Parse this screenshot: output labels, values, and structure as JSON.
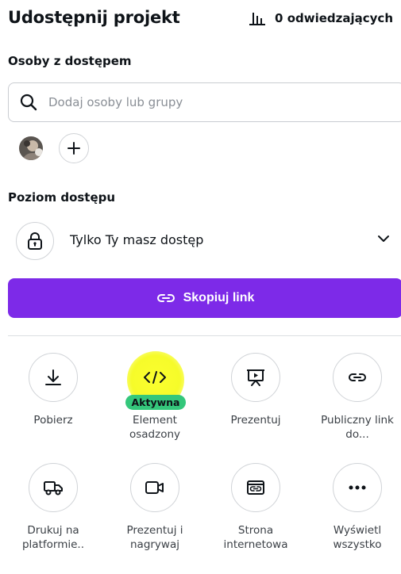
{
  "header": {
    "title": "Udostępnij projekt",
    "visitors": "0 odwiedzających"
  },
  "people": {
    "label": "Osoby z dostępem",
    "search_placeholder": "Dodaj osoby lub grupy"
  },
  "access": {
    "label": "Poziom dostępu",
    "value": "Tylko Ty masz dostęp"
  },
  "copy_link": {
    "label": "Skopiuj link"
  },
  "actions": [
    {
      "label": "Pobierz",
      "icon": "download-icon"
    },
    {
      "label": "Element osadzony",
      "icon": "embed-code-icon",
      "badge": "Aktywna"
    },
    {
      "label": "Prezentuj",
      "icon": "present-icon"
    },
    {
      "label": "Publiczny link do...",
      "icon": "link-icon"
    },
    {
      "label": "Drukuj na platformie..",
      "icon": "truck-icon"
    },
    {
      "label": "Prezentuj i nagrywaj",
      "icon": "video-camera-icon"
    },
    {
      "label": "Strona internetowa",
      "icon": "website-icon"
    },
    {
      "label": "Wyświetl wszystko",
      "icon": "more-icon"
    }
  ],
  "colors": {
    "primary": "#7d2ae8",
    "badge": "#34c77b",
    "highlight": "#f6fb2a"
  }
}
